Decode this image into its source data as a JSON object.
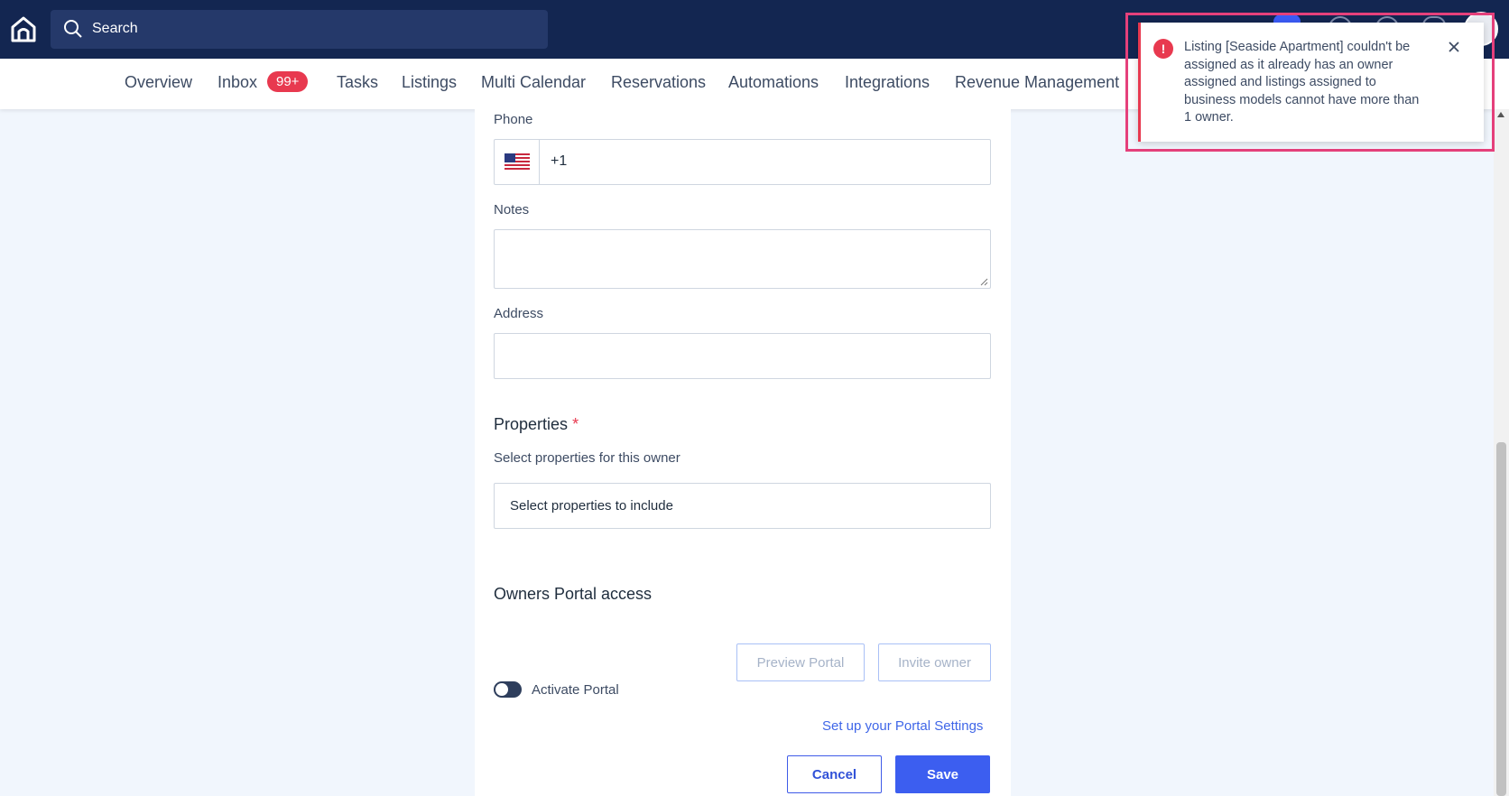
{
  "header": {
    "search_placeholder": "Search",
    "icons": [
      "home-icon",
      "search-icon",
      "help-icon",
      "chat-icon",
      "bell-icon",
      "avatar"
    ]
  },
  "nav": {
    "items": [
      "Overview",
      "Inbox",
      "Tasks",
      "Listings",
      "Multi Calendar",
      "Reservations",
      "Automations",
      "Integrations",
      "Revenue Management"
    ],
    "inbox_badge": "99+"
  },
  "form": {
    "phone_label": "Phone",
    "phone_value": "+1",
    "notes_label": "Notes",
    "address_label": "Address",
    "properties_title": "Properties",
    "required_mark": "*",
    "properties_hint": "Select properties for this owner",
    "properties_placeholder": "Select properties to include",
    "portal_title": "Owners Portal access",
    "preview_portal": "Preview Portal",
    "invite_owner": "Invite owner",
    "activate_portal": "Activate Portal",
    "portal_settings_link": "Set up your Portal Settings",
    "cancel": "Cancel",
    "save": "Save"
  },
  "toast": {
    "icon": "!",
    "message": "Listing [Seaside Apartment] couldn't be assigned as it already has an owner assigned and listings assigned to business models cannot have more than 1 owner."
  },
  "colors": {
    "topbar": "#132651",
    "accent": "#3c5ef0",
    "error": "#e8394f",
    "highlight": "#e5407b"
  }
}
